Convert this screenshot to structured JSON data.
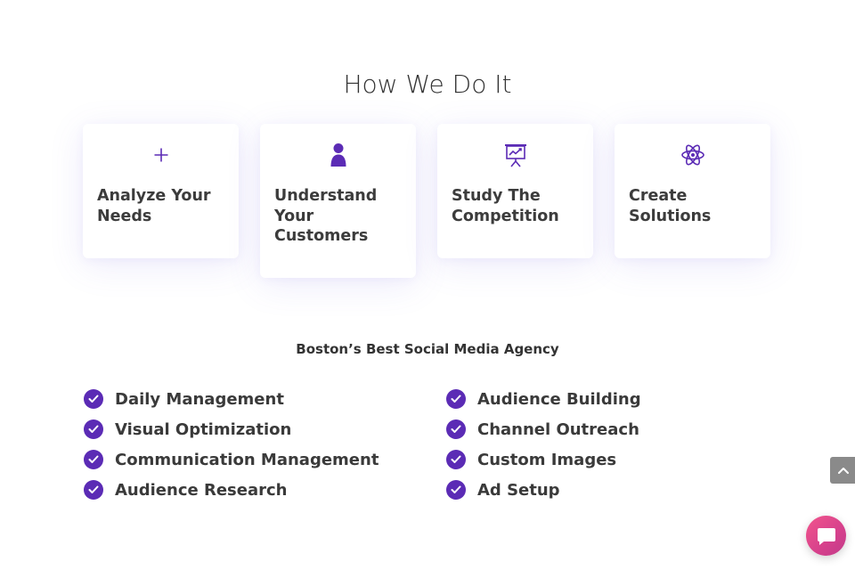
{
  "section": {
    "title": "How We Do It"
  },
  "cards": [
    {
      "icon": "plus-icon",
      "label": "Analyze Your Needs"
    },
    {
      "icon": "person-icon",
      "label": "Understand Your Customers"
    },
    {
      "icon": "presentation-chart-icon",
      "label": "Study The Competition"
    },
    {
      "icon": "atom-icon",
      "label": "Create Solutions"
    }
  ],
  "agency": {
    "heading": "Boston’s Best Social Media Agency"
  },
  "features": {
    "left": [
      "Daily Management",
      "Visual Optimization",
      "Communication Management",
      "Audience Research"
    ],
    "right": [
      "Audience Building",
      "Channel Outreach",
      "Custom Images",
      "Ad Setup"
    ]
  },
  "widgets": {
    "scroll_top_icon": "chevron-up-icon",
    "chat_icon": "chat-bubble-icon"
  },
  "colors": {
    "accent": "#5b2bb5",
    "chat_gradient_start": "#f2558d",
    "chat_gradient_end": "#c23b8a",
    "scroll_button": "#8a8a8a"
  }
}
